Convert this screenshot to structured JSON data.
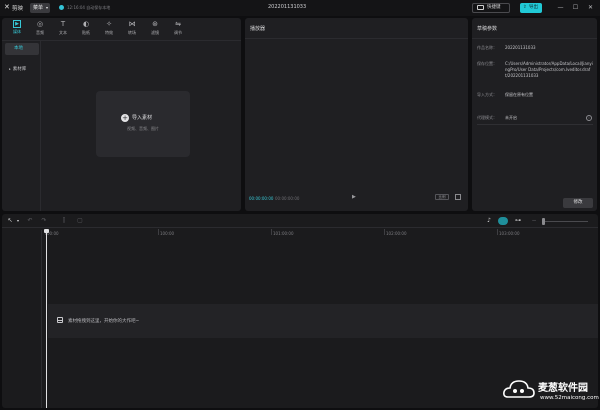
{
  "titlebar": {
    "app_name": "剪映",
    "menu_label": "菜单",
    "autosave_text": "12:16:04 自动保存本地",
    "project_title": "202201131033",
    "shortcut_label": "快捷键",
    "export_label": "导出"
  },
  "media": {
    "tabs": [
      {
        "label": "媒体",
        "icon": "media-icon"
      },
      {
        "label": "音频",
        "icon": "audio-icon"
      },
      {
        "label": "文本",
        "icon": "text-icon"
      },
      {
        "label": "贴纸",
        "icon": "sticker-icon"
      },
      {
        "label": "特效",
        "icon": "effects-icon"
      },
      {
        "label": "转场",
        "icon": "transition-icon"
      },
      {
        "label": "滤镜",
        "icon": "filter-icon"
      },
      {
        "label": "调节",
        "icon": "adjust-icon"
      }
    ],
    "side_local": "本地",
    "side_library": "素材库",
    "import_label": "导入素材",
    "import_hint": "视频、音频、图片"
  },
  "player": {
    "title": "播放器",
    "timecode_current": "00:00:00:00",
    "timecode_total": "00:00:00:00",
    "ratio_label": "比例"
  },
  "params": {
    "title": "草稿参数",
    "rows": [
      {
        "key": "作品名称：",
        "value": "202201131033"
      },
      {
        "key": "保存位置：",
        "value": "C:/Users/Administrator/AppData/Local/JianyingPro/User Data/Projects/com.lveditor.draft/202201131033"
      },
      {
        "key": "导入方式：",
        "value": "保留在原有位置"
      },
      {
        "key": "代理模式：",
        "value": "未开启"
      }
    ],
    "modify_label": "修改"
  },
  "timeline": {
    "ticks": [
      "00:00",
      "100:00",
      "101:00:00",
      "102:00:00",
      "103:00:00"
    ],
    "drop_hint": "素材拖拽到这里，开始你的大作吧~"
  },
  "watermark": {
    "title": "麦葱软件园",
    "url": "www.52maicong.com"
  },
  "colors": {
    "accent": "#37c8d6",
    "export_bg": "#21c9d6",
    "panel_bg": "#1f1f22"
  }
}
